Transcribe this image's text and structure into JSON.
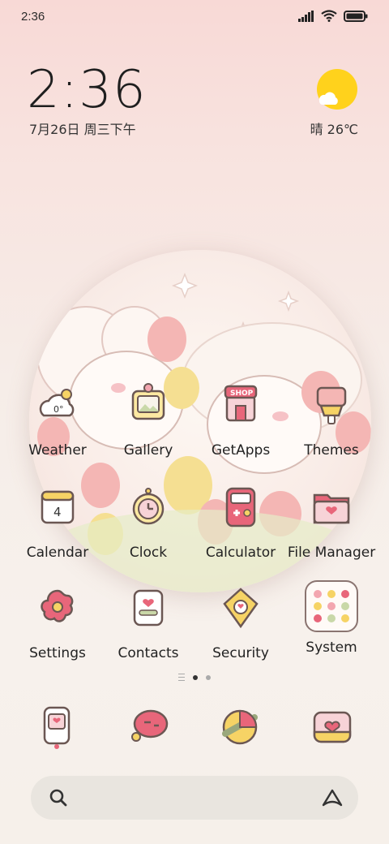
{
  "status": {
    "time": "2:36"
  },
  "clock": {
    "time": "2:36",
    "date": "7月26日 周三下午"
  },
  "weather": {
    "text": "晴 26℃",
    "icon": "sun-cloud-icon",
    "app_temp": "0°"
  },
  "apps": [
    {
      "label": "Weather",
      "icon": "weather-icon"
    },
    {
      "label": "Gallery",
      "icon": "gallery-icon"
    },
    {
      "label": "GetApps",
      "icon": "shop-icon",
      "badge": "SHOP"
    },
    {
      "label": "Themes",
      "icon": "themes-icon"
    },
    {
      "label": "Calendar",
      "icon": "calendar-icon",
      "day": "4"
    },
    {
      "label": "Clock",
      "icon": "clock-icon"
    },
    {
      "label": "Calculator",
      "icon": "calculator-icon"
    },
    {
      "label": "File Manager",
      "icon": "folder-icon"
    },
    {
      "label": "Settings",
      "icon": "settings-icon"
    },
    {
      "label": "Contacts",
      "icon": "contacts-icon"
    },
    {
      "label": "Security",
      "icon": "shield-icon"
    },
    {
      "label": "System",
      "icon": "folder-grid-icon"
    }
  ],
  "dock": [
    {
      "icon": "phone-icon"
    },
    {
      "icon": "messages-icon"
    },
    {
      "icon": "browser-icon"
    },
    {
      "icon": "camera-icon"
    }
  ],
  "colors": {
    "accent": "#e8667a",
    "pink": "#f3a6b0",
    "yellow": "#f6d365",
    "weather_sun": "#ffd21c"
  }
}
